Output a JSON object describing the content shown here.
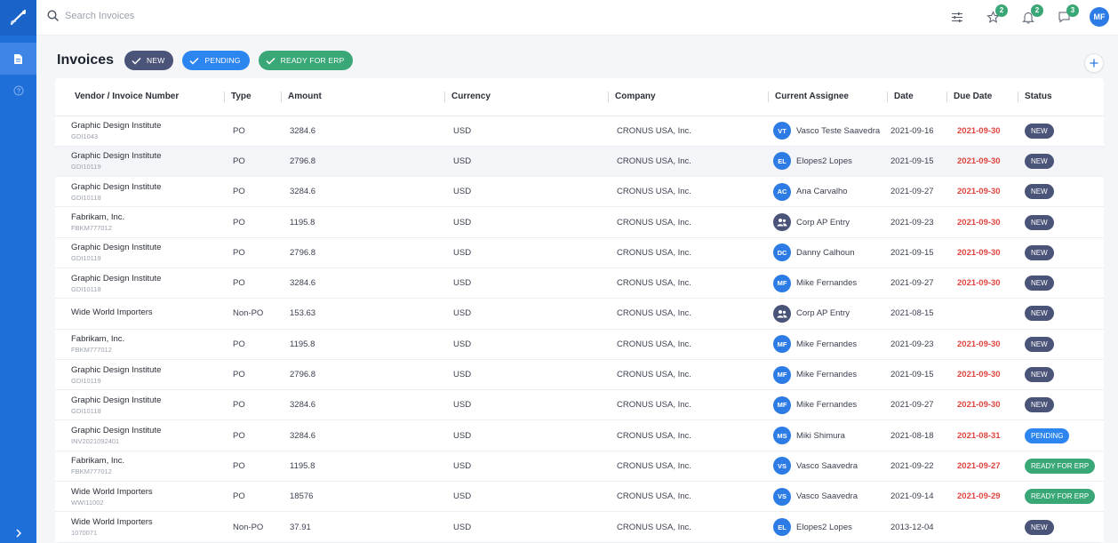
{
  "search": {
    "placeholder": "Search Invoices"
  },
  "topbar": {
    "icons": [
      {
        "name": "filter-sliders-icon",
        "badge": ""
      },
      {
        "name": "star-icon",
        "badge": "2"
      },
      {
        "name": "bell-icon",
        "badge": "2"
      },
      {
        "name": "chat-icon",
        "badge": "3"
      }
    ],
    "user_initials": "MF"
  },
  "page": {
    "title": "Invoices",
    "filters": [
      "NEW",
      "PENDING",
      "READY FOR ERP"
    ]
  },
  "table": {
    "columns": [
      "Vendor / Invoice Number",
      "Type",
      "Amount",
      "Currency",
      "Company",
      "Current Assignee",
      "Date",
      "Due Date",
      "Status"
    ],
    "rows": [
      {
        "vendor": "Graphic Design Institute",
        "number": "GDI1043",
        "type": "PO",
        "amount": "3284.6",
        "currency": "USD",
        "company": "CRONUS USA, Inc.",
        "initials": "VT",
        "group": false,
        "assignee": "Vasco Teste Saavedra",
        "date": "2021-09-16",
        "due": "2021-09-30",
        "status": "NEW",
        "status_kind": "new"
      },
      {
        "vendor": "Graphic Design Institute",
        "number": "GDI10119",
        "type": "PO",
        "amount": "2796.8",
        "currency": "USD",
        "company": "CRONUS USA, Inc.",
        "initials": "EL",
        "group": false,
        "assignee": "Elopes2 Lopes",
        "date": "2021-09-15",
        "due": "2021-09-30",
        "status": "NEW",
        "status_kind": "new"
      },
      {
        "vendor": "Graphic Design Institute",
        "number": "GDI10118",
        "type": "PO",
        "amount": "3284.6",
        "currency": "USD",
        "company": "CRONUS USA, Inc.",
        "initials": "AC",
        "group": false,
        "assignee": "Ana Carvalho",
        "date": "2021-09-27",
        "due": "2021-09-30",
        "status": "NEW",
        "status_kind": "new"
      },
      {
        "vendor": "Fabrikam, Inc.",
        "number": "FBKM777012",
        "type": "PO",
        "amount": "1195.8",
        "currency": "USD",
        "company": "CRONUS USA, Inc.",
        "initials": "",
        "group": true,
        "assignee": "Corp AP Entry",
        "date": "2021-09-23",
        "due": "2021-09-30",
        "status": "NEW",
        "status_kind": "new"
      },
      {
        "vendor": "Graphic Design Institute",
        "number": "GDI10119",
        "type": "PO",
        "amount": "2796.8",
        "currency": "USD",
        "company": "CRONUS USA, Inc.",
        "initials": "DC",
        "group": false,
        "assignee": "Danny Calhoun",
        "date": "2021-09-15",
        "due": "2021-09-30",
        "status": "NEW",
        "status_kind": "new"
      },
      {
        "vendor": "Graphic Design Institute",
        "number": "GDI10118",
        "type": "PO",
        "amount": "3284.6",
        "currency": "USD",
        "company": "CRONUS USA, Inc.",
        "initials": "MF",
        "group": false,
        "assignee": "Mike Fernandes",
        "date": "2021-09-27",
        "due": "2021-09-30",
        "status": "NEW",
        "status_kind": "new"
      },
      {
        "vendor": "Wide World Importers",
        "number": "",
        "type": "Non-PO",
        "amount": "153.63",
        "currency": "USD",
        "company": "CRONUS USA, Inc.",
        "initials": "",
        "group": true,
        "assignee": "Corp AP Entry",
        "date": "2021-08-15",
        "due": "",
        "status": "NEW",
        "status_kind": "new"
      },
      {
        "vendor": "Fabrikam, Inc.",
        "number": "FBKM777012",
        "type": "PO",
        "amount": "1195.8",
        "currency": "USD",
        "company": "CRONUS USA, Inc.",
        "initials": "MF",
        "group": false,
        "assignee": "Mike Fernandes",
        "date": "2021-09-23",
        "due": "2021-09-30",
        "status": "NEW",
        "status_kind": "new"
      },
      {
        "vendor": "Graphic Design Institute",
        "number": "GDI10119",
        "type": "PO",
        "amount": "2796.8",
        "currency": "USD",
        "company": "CRONUS USA, Inc.",
        "initials": "MF",
        "group": false,
        "assignee": "Mike Fernandes",
        "date": "2021-09-15",
        "due": "2021-09-30",
        "status": "NEW",
        "status_kind": "new"
      },
      {
        "vendor": "Graphic Design Institute",
        "number": "GDI10118",
        "type": "PO",
        "amount": "3284.6",
        "currency": "USD",
        "company": "CRONUS USA, Inc.",
        "initials": "MF",
        "group": false,
        "assignee": "Mike Fernandes",
        "date": "2021-09-27",
        "due": "2021-09-30",
        "status": "NEW",
        "status_kind": "new"
      },
      {
        "vendor": "Graphic Design Institute",
        "number": "INV2021092401",
        "type": "PO",
        "amount": "3284.6",
        "currency": "USD",
        "company": "CRONUS USA, Inc.",
        "initials": "MS",
        "group": false,
        "assignee": "Miki Shimura",
        "date": "2021-08-18",
        "due": "2021-08-31",
        "status": "PENDING",
        "status_kind": "pending"
      },
      {
        "vendor": "Fabrikam, Inc.",
        "number": "FBKM777012",
        "type": "PO",
        "amount": "1195.8",
        "currency": "USD",
        "company": "CRONUS USA, Inc.",
        "initials": "VS",
        "group": false,
        "assignee": "Vasco Saavedra",
        "date": "2021-09-22",
        "due": "2021-09-27",
        "status": "READY FOR ERP",
        "status_kind": "ready"
      },
      {
        "vendor": "Wide World Importers",
        "number": "WWI11002",
        "type": "PO",
        "amount": "18576",
        "currency": "USD",
        "company": "CRONUS USA, Inc.",
        "initials": "VS",
        "group": false,
        "assignee": "Vasco Saavedra",
        "date": "2021-09-14",
        "due": "2021-09-29",
        "status": "READY FOR ERP",
        "status_kind": "ready"
      },
      {
        "vendor": "Wide World Importers",
        "number": "1070071",
        "type": "Non-PO",
        "amount": "37.91",
        "currency": "USD",
        "company": "CRONUS USA, Inc.",
        "initials": "EL",
        "group": false,
        "assignee": "Elopes2 Lopes",
        "date": "2013-12-04",
        "due": "",
        "status": "NEW",
        "status_kind": "new"
      }
    ]
  },
  "colors": {
    "rail": "#1f6fd8",
    "accent": "#2d7be5",
    "new": "#4a5478",
    "pending": "#2d86f0",
    "ready": "#3aa876",
    "overdue": "#e0453f"
  }
}
